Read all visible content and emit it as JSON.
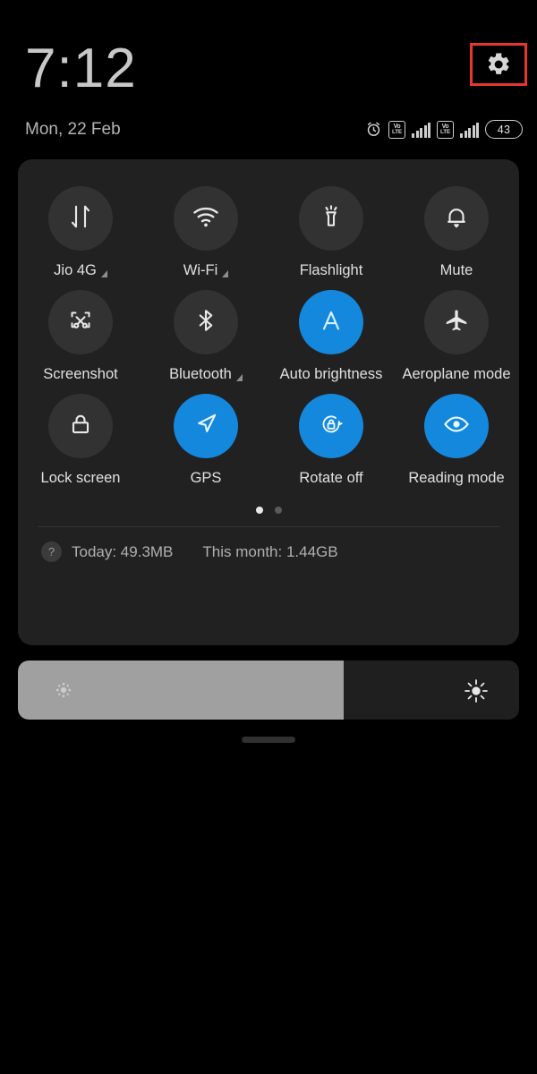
{
  "statusbar": {
    "clock": "7:12",
    "date": "Mon, 22 Feb",
    "battery_level": "43",
    "icons": [
      "alarm-icon",
      "volte-icon",
      "signal-bars-icon",
      "volte-icon",
      "signal-bars-icon",
      "battery-icon"
    ],
    "volte_top": "Vo",
    "volte_bottom": "LTE",
    "settings_label": "gear-icon",
    "highlight_color": "#e8352e"
  },
  "colors": {
    "panel_bg": "#212121",
    "tile_off": "#323232",
    "tile_on": "#1488dd",
    "slider_fill": "#a0a0a0",
    "slider_track": "#1f1f1f"
  },
  "quick_settings": {
    "rows": [
      [
        {
          "label": "Jio 4G",
          "icon": "data-transfer-icon",
          "active": false,
          "expandable": true
        },
        {
          "label": "Wi-Fi",
          "icon": "wifi-icon",
          "active": false,
          "expandable": true
        },
        {
          "label": "Flashlight",
          "icon": "flashlight-icon",
          "active": false,
          "expandable": false
        },
        {
          "label": "Mute",
          "icon": "bell-icon",
          "active": false,
          "expandable": false
        }
      ],
      [
        {
          "label": "Screenshot",
          "icon": "screenshot-scissors-icon",
          "active": false,
          "expandable": false
        },
        {
          "label": "Bluetooth",
          "icon": "bluetooth-icon",
          "active": false,
          "expandable": true
        },
        {
          "label": "Auto brightness",
          "icon": "auto-brightness-a-icon",
          "active": true,
          "expandable": false
        },
        {
          "label": "Aeroplane mode",
          "icon": "airplane-icon",
          "active": false,
          "expandable": false
        }
      ],
      [
        {
          "label": "Lock screen",
          "icon": "padlock-icon",
          "active": false,
          "expandable": false
        },
        {
          "label": "GPS",
          "icon": "navigation-arrow-icon",
          "active": true,
          "expandable": false
        },
        {
          "label": "Rotate off",
          "icon": "rotate-lock-icon",
          "active": true,
          "expandable": false
        },
        {
          "label": "Reading mode",
          "icon": "eye-icon",
          "active": true,
          "expandable": false
        }
      ]
    ],
    "pages": {
      "count": 2,
      "active_index": 0
    }
  },
  "data_usage": {
    "help_label": "?",
    "today": "Today: 49.3MB",
    "month": "This month: 1.44GB"
  },
  "brightness": {
    "fill_percent": "65",
    "low_icon": "brightness-low-icon",
    "high_icon": "brightness-high-icon"
  },
  "handle": {
    "name": "drag-handle"
  }
}
